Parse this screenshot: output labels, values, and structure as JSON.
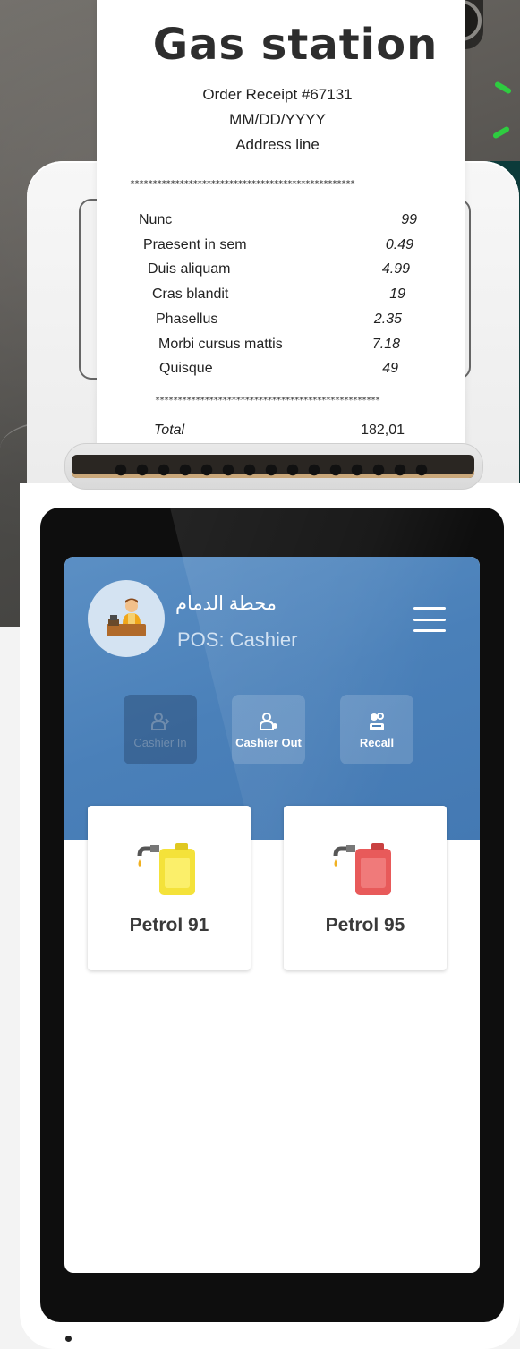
{
  "receipt": {
    "title": "Gas station",
    "order": "Order Receipt #67131",
    "date": "MM/DD/YYYY",
    "address": "Address line",
    "separator": "**************************************************",
    "items": [
      {
        "name": "Nunc",
        "value": "99"
      },
      {
        "name": "Praesent in sem",
        "value": "0.49"
      },
      {
        "name": "Duis aliquam",
        "value": "4.99"
      },
      {
        "name": "Cras blandit",
        "value": "19"
      },
      {
        "name": "Phasellus",
        "value": "2.35"
      },
      {
        "name": "Morbi cursus mattis",
        "value": "7.18"
      },
      {
        "name": "Quisque",
        "value": "49"
      }
    ],
    "total_label": "Total",
    "total_value": "182,01"
  },
  "app": {
    "station_name": "محطة الدمام",
    "role": "POS: Cashier",
    "actions": [
      {
        "label": "Cashier In",
        "icon": "cashier-in-icon",
        "state": "disabled"
      },
      {
        "label": "Cashier Out",
        "icon": "cashier-out-icon",
        "state": "enabled"
      },
      {
        "label": "Recall",
        "icon": "recall-icon",
        "state": "enabled"
      }
    ],
    "fuels": [
      {
        "label": "Petrol 91",
        "color": "#f4e23a"
      },
      {
        "label": "Petrol 95",
        "color": "#e85a5a"
      }
    ]
  },
  "colors": {
    "header_blue": "#4a80b9",
    "accent_green": "#2ecc40"
  }
}
